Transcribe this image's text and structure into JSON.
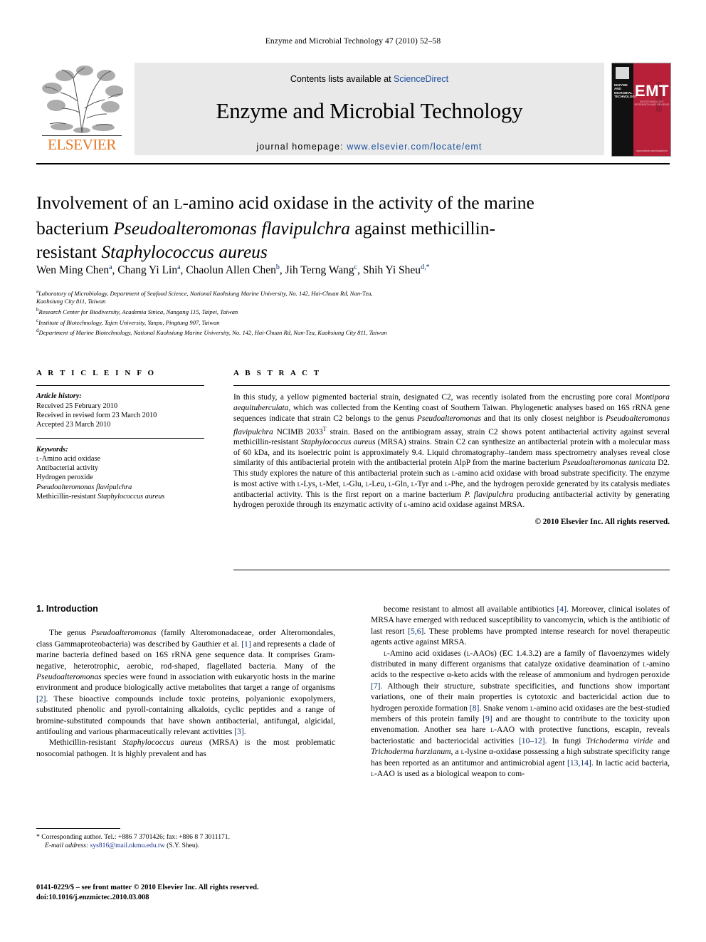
{
  "running_head": "Enzyme and Microbial Technology 47 (2010) 52–58",
  "masthead": {
    "contents_prefix": "Contents lists available at ",
    "sciencedirect": "ScienceDirect",
    "journal_title": "Enzyme and Microbial Technology",
    "homepage_prefix": "journal homepage:",
    "homepage_url": "www.elsevier.com/locate/emt",
    "publisher": "ELSEVIER",
    "cover": {
      "journal_name": "ENZYME AND MICROBIAL TECHNOLOGY",
      "acronym": "EMT",
      "tagline": "BIOTECHNOLOGY RESEARCH AND REVIEWS",
      "url": "www.elsevier.com/locate/emt"
    }
  },
  "article": {
    "title_part1": "Involvement of an ",
    "title_l": "L",
    "title_part2": "-amino acid oxidase in the activity of the marine bacterium ",
    "title_species1": "Pseudoalteromonas flavipulchra",
    "title_part3": " against methicillin-resistant ",
    "title_species2": "Staphylococcus aureus",
    "authors": [
      {
        "name": "Wen Ming Chen",
        "sup": "a"
      },
      {
        "name": "Chang Yi Lin",
        "sup": "a"
      },
      {
        "name": "Chaolun Allen Chen",
        "sup": "b"
      },
      {
        "name": "Jih Terng Wang",
        "sup": "c"
      },
      {
        "name": "Shih Yi Sheu",
        "sup": "d,*"
      }
    ],
    "affiliations": [
      {
        "label": "a",
        "lines": [
          "Laboratory of Microbiology, Department of Seafood Science, National Kaohsiung Marine University, No. 142, Hai-Chuan Rd, Nan-Tzu,",
          "Kaohsiung City 811, Taiwan"
        ]
      },
      {
        "label": "b",
        "lines": [
          "Research Center for Biodiversity, Academia Sinica, Nangang 115, Taipei, Taiwan"
        ]
      },
      {
        "label": "c",
        "lines": [
          "Institute of Biotechnology, Tajen University, Yanpu, Pingtung 907, Taiwan"
        ]
      },
      {
        "label": "d",
        "lines": [
          "Department of Marine Biotechnology, National Kaohsiung Marine University, No. 142, Hai-Chuan Rd, Nan-Tzu, Kaohsiung City 811, Taiwan"
        ]
      }
    ]
  },
  "article_info": {
    "heading": "A R T I C L E   I N F O",
    "history_label": "Article history:",
    "history": [
      "Received 25 February 2010",
      "Received in revised form 23 March 2010",
      "Accepted 23 March 2010"
    ],
    "keywords_label": "Keywords:",
    "keywords": [
      "L-Amino acid oxidase",
      "Antibacterial activity",
      "Hydrogen peroxide",
      "Pseudoalteromonas flavipulchra",
      "Methicillin-resistant Staphylococcus aureus"
    ]
  },
  "abstract": {
    "heading": "A B S T R A C T",
    "text": "In this study, a yellow pigmented bacterial strain, designated C2, was recently isolated from the encrusting pore coral Montipora aequituberculata, which was collected from the Kenting coast of Southern Taiwan. Phylogenetic analyses based on 16S rRNA gene sequences indicate that strain C2 belongs to the genus Pseudoalteromonas and that its only closest neighbor is Pseudoalteromonas flavipulchra NCIMB 2033T strain. Based on the antibiogram assay, strain C2 shows potent antibacterial activity against several methicillin-resistant Staphylococcus aureus (MRSA) strains. Strain C2 can synthesize an antibacterial protein with a molecular mass of 60 kDa, and its isoelectric point is approximately 9.4. Liquid chromatography–tandem mass spectrometry analyses reveal close similarity of this antibacterial protein with the antibacterial protein AlpP from the marine bacterium Pseudoalteromonas tunicata D2. This study explores the nature of this antibacterial protein such as L-amino acid oxidase with broad substrate specificity. The enzyme is most active with L-Lys, L-Met, L-Glu, L-Leu, L-Gln, L-Tyr and L-Phe, and the hydrogen peroxide generated by its catalysis mediates antibacterial activity. This is the first report on a marine bacterium P. flavipulchra producing antibacterial activity by generating hydrogen peroxide through its enzymatic activity of L-amino acid oxidase against MRSA.",
    "copyright": "© 2010 Elsevier Inc. All rights reserved."
  },
  "introduction": {
    "heading": "1. Introduction",
    "left_paragraphs": [
      "The genus Pseudoalteromonas (family Alteromonadaceae, order Alteromondales, class Gammaproteobacteria) was described by Gauthier et al. [1] and represents a clade of marine bacteria defined based on 16S rRNA gene sequence data. It comprises Gram-negative, heterotrophic, aerobic, rod-shaped, flagellated bacteria. Many of the Pseudoalteromonas species were found in association with eukaryotic hosts in the marine environment and produce biologically active metabolites that target a range of organisms [2]. These bioactive compounds include toxic proteins, polyanionic exopolymers, substituted phenolic and pyroll-containing alkaloids, cyclic peptides and a range of bromine-substituted compounds that have shown antibacterial, antifungal, algicidal, antifouling and various pharmaceutically relevant activities [3].",
      "Methicillin-resistant Staphylococcus aureus (MRSA) is the most problematic nosocomial pathogen. It is highly prevalent and has"
    ],
    "right_paragraphs": [
      "become resistant to almost all available antibiotics [4]. Moreover, clinical isolates of MRSA have emerged with reduced susceptibility to vancomycin, which is the antibiotic of last resort [5,6]. These problems have prompted intense research for novel therapeutic agents active against MRSA.",
      "L-Amino acid oxidases (L-AAOs) (EC 1.4.3.2) are a family of flavoenzymes widely distributed in many different organisms that catalyze oxidative deamination of L-amino acids to the respective α-keto acids with the release of ammonium and hydrogen peroxide [7]. Although their structure, substrate specificities, and functions show important variations, one of their main properties is cytotoxic and bactericidal action due to hydrogen peroxide formation [8]. Snake venom L-amino acid oxidases are the best-studied members of this protein family [9] and are thought to contribute to the toxicity upon envenomation. Another sea hare L-AAO with protective functions, escapin, reveals bacteriostatic and bacteriocidal activities [10–12]. In fungi Trichoderma viride and Trichoderma harzianum, a L-lysine α-oxidase possessing a high substrate specificity range has been reported as an antitumor and antimicrobial agent [13,14]. In lactic acid bacteria, L-AAO is used as a biological weapon to com-"
    ]
  },
  "footnotes": {
    "corresponding": "* Corresponding author. Tel.: +886 7 3701426; fax: +886 8 7 3011171.",
    "email_label": "E-mail address:",
    "email": "sys816@mail.nkmu.edu.tw",
    "email_suffix": "(S.Y. Sheu).",
    "imprint_line1": "0141-0229/$ – see front matter © 2010 Elsevier Inc. All rights reserved.",
    "imprint_line2": "doi:10.1016/j.enzmictec.2010.03.008"
  },
  "colors": {
    "link_blue": "#1a4f9c",
    "ref_blue": "#0d2d6b",
    "elsevier_orange": "#e87722",
    "cover_red": "#b8203a",
    "banner_gray": "#e9e9e9"
  }
}
